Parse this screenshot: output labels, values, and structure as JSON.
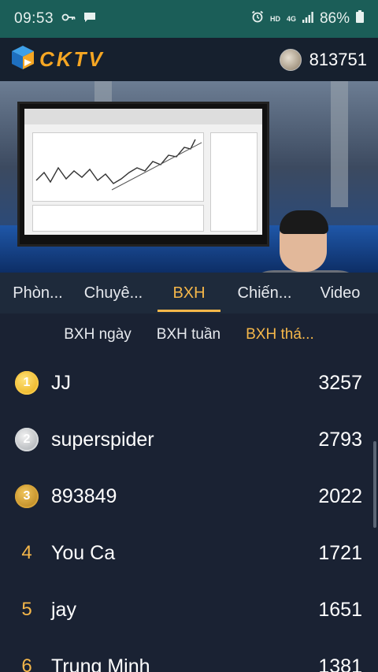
{
  "status_bar": {
    "time": "09:53",
    "hd": "HD",
    "network": "4G",
    "battery": "86%"
  },
  "header": {
    "app_name": "CKTV",
    "points": "813751"
  },
  "tabs": [
    {
      "label": "Phòn..."
    },
    {
      "label": "Chuyê..."
    },
    {
      "label": "BXH",
      "active": true
    },
    {
      "label": "Chiến..."
    },
    {
      "label": "Video"
    }
  ],
  "subtabs": [
    {
      "label": "BXH ngày"
    },
    {
      "label": "BXH tuần"
    },
    {
      "label": "BXH thá...",
      "active": true
    }
  ],
  "ranking": [
    {
      "rank": "1",
      "name": "JJ",
      "score": "3257"
    },
    {
      "rank": "2",
      "name": "superspider",
      "score": "2793"
    },
    {
      "rank": "3",
      "name": "893849",
      "score": "2022"
    },
    {
      "rank": "4",
      "name": "You Ca",
      "score": "1721"
    },
    {
      "rank": "5",
      "name": "jay",
      "score": "1651"
    },
    {
      "rank": "6",
      "name": "Trung Minh",
      "score": "1381"
    }
  ],
  "colors": {
    "accent": "#f5b74a",
    "background": "#1a2233",
    "status_bar": "#1b5e58"
  }
}
